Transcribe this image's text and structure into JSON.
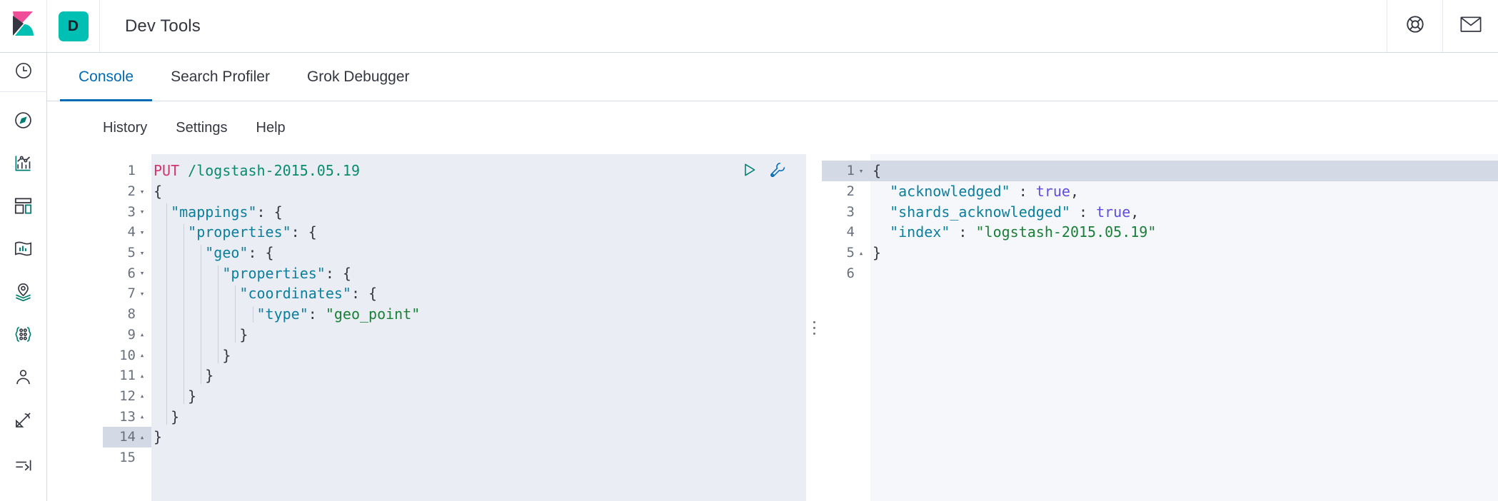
{
  "header": {
    "logo_icon": "kibana-logo",
    "app_badge_letter": "D",
    "title": "Dev Tools",
    "help_icon": "life-ring-icon",
    "mail_icon": "envelope-icon",
    "colors": {
      "badge_bg": "#00bfb3",
      "logo_pink": "#f04e98",
      "logo_teal": "#00bfb3",
      "logo_dark": "#343741"
    }
  },
  "sidebar": {
    "items": [
      {
        "name": "recently-viewed",
        "icon": "clock-icon"
      },
      {
        "name": "discover",
        "icon": "compass-icon"
      },
      {
        "name": "visualize",
        "icon": "bar-chart-icon"
      },
      {
        "name": "dashboard",
        "icon": "dashboard-icon"
      },
      {
        "name": "canvas",
        "icon": "canvas-icon"
      },
      {
        "name": "maps",
        "icon": "map-pin-icon"
      },
      {
        "name": "machine-learning",
        "icon": "machine-learning-icon"
      },
      {
        "name": "infrastructure",
        "icon": "infrastructure-icon"
      },
      {
        "name": "logs",
        "icon": "logs-icon"
      }
    ],
    "collapse": {
      "name": "collapse-nav",
      "icon": "arrow-right-to-line-icon"
    }
  },
  "tabs": [
    {
      "label": "Console",
      "active": true
    },
    {
      "label": "Search Profiler",
      "active": false
    },
    {
      "label": "Grok Debugger",
      "active": false
    }
  ],
  "console_menu": [
    {
      "label": "History"
    },
    {
      "label": "Settings"
    },
    {
      "label": "Help"
    }
  ],
  "actions": {
    "play": {
      "label": "Click to send request",
      "icon": "play-icon",
      "color": "#017d73"
    },
    "wrench": {
      "label": "Open documentation",
      "icon": "wrench-icon",
      "color": "#006bb4"
    }
  },
  "request_editor": {
    "active_line": 14,
    "total_lines": 15,
    "lines": [
      {
        "n": 1,
        "fold": "none",
        "indent": 0,
        "tokens": [
          {
            "t": "method",
            "v": "PUT"
          },
          {
            "t": "punc",
            "v": " "
          },
          {
            "t": "url",
            "v": "/logstash-2015.05.19"
          }
        ]
      },
      {
        "n": 2,
        "fold": "open",
        "indent": 0,
        "tokens": [
          {
            "t": "punc",
            "v": "{"
          }
        ]
      },
      {
        "n": 3,
        "fold": "open",
        "indent": 1,
        "tokens": [
          {
            "t": "key",
            "v": "\"mappings\""
          },
          {
            "t": "punc",
            "v": ": {"
          }
        ]
      },
      {
        "n": 4,
        "fold": "open",
        "indent": 2,
        "tokens": [
          {
            "t": "key",
            "v": "\"properties\""
          },
          {
            "t": "punc",
            "v": ": {"
          }
        ]
      },
      {
        "n": 5,
        "fold": "open",
        "indent": 3,
        "tokens": [
          {
            "t": "key",
            "v": "\"geo\""
          },
          {
            "t": "punc",
            "v": ": {"
          }
        ]
      },
      {
        "n": 6,
        "fold": "open",
        "indent": 4,
        "tokens": [
          {
            "t": "key",
            "v": "\"properties\""
          },
          {
            "t": "punc",
            "v": ": {"
          }
        ]
      },
      {
        "n": 7,
        "fold": "open",
        "indent": 5,
        "tokens": [
          {
            "t": "key",
            "v": "\"coordinates\""
          },
          {
            "t": "punc",
            "v": ": {"
          }
        ]
      },
      {
        "n": 8,
        "fold": "none",
        "indent": 6,
        "tokens": [
          {
            "t": "key",
            "v": "\"type\""
          },
          {
            "t": "punc",
            "v": ": "
          },
          {
            "t": "string",
            "v": "\"geo_point\""
          }
        ]
      },
      {
        "n": 9,
        "fold": "close",
        "indent": 5,
        "tokens": [
          {
            "t": "punc",
            "v": "}"
          }
        ]
      },
      {
        "n": 10,
        "fold": "close",
        "indent": 4,
        "tokens": [
          {
            "t": "punc",
            "v": "}"
          }
        ]
      },
      {
        "n": 11,
        "fold": "close",
        "indent": 3,
        "tokens": [
          {
            "t": "punc",
            "v": "}"
          }
        ]
      },
      {
        "n": 12,
        "fold": "close",
        "indent": 2,
        "tokens": [
          {
            "t": "punc",
            "v": "}"
          }
        ]
      },
      {
        "n": 13,
        "fold": "close",
        "indent": 1,
        "tokens": [
          {
            "t": "punc",
            "v": "}"
          }
        ]
      },
      {
        "n": 14,
        "fold": "close",
        "indent": 0,
        "tokens": [
          {
            "t": "punc",
            "v": "}"
          }
        ]
      },
      {
        "n": 15,
        "fold": "none",
        "indent": 0,
        "tokens": []
      }
    ]
  },
  "response_editor": {
    "active_line": 1,
    "total_lines": 6,
    "lines": [
      {
        "n": 1,
        "fold": "open",
        "indent": 0,
        "tokens": [
          {
            "t": "punc",
            "v": "{"
          }
        ]
      },
      {
        "n": 2,
        "fold": "none",
        "indent": 1,
        "tokens": [
          {
            "t": "key",
            "v": "\"acknowledged\""
          },
          {
            "t": "punc",
            "v": " : "
          },
          {
            "t": "bool",
            "v": "true"
          },
          {
            "t": "punc",
            "v": ","
          }
        ]
      },
      {
        "n": 3,
        "fold": "none",
        "indent": 1,
        "tokens": [
          {
            "t": "key",
            "v": "\"shards_acknowledged\""
          },
          {
            "t": "punc",
            "v": " : "
          },
          {
            "t": "bool",
            "v": "true"
          },
          {
            "t": "punc",
            "v": ","
          }
        ]
      },
      {
        "n": 4,
        "fold": "none",
        "indent": 1,
        "tokens": [
          {
            "t": "key",
            "v": "\"index\""
          },
          {
            "t": "punc",
            "v": " : "
          },
          {
            "t": "string",
            "v": "\"logstash-2015.05.19\""
          }
        ]
      },
      {
        "n": 5,
        "fold": "close",
        "indent": 0,
        "tokens": [
          {
            "t": "punc",
            "v": "}"
          }
        ]
      },
      {
        "n": 6,
        "fold": "none",
        "indent": 0,
        "tokens": []
      }
    ]
  },
  "splitter": {
    "name": "editor-splitter",
    "icon": "drag-dots-icon"
  }
}
